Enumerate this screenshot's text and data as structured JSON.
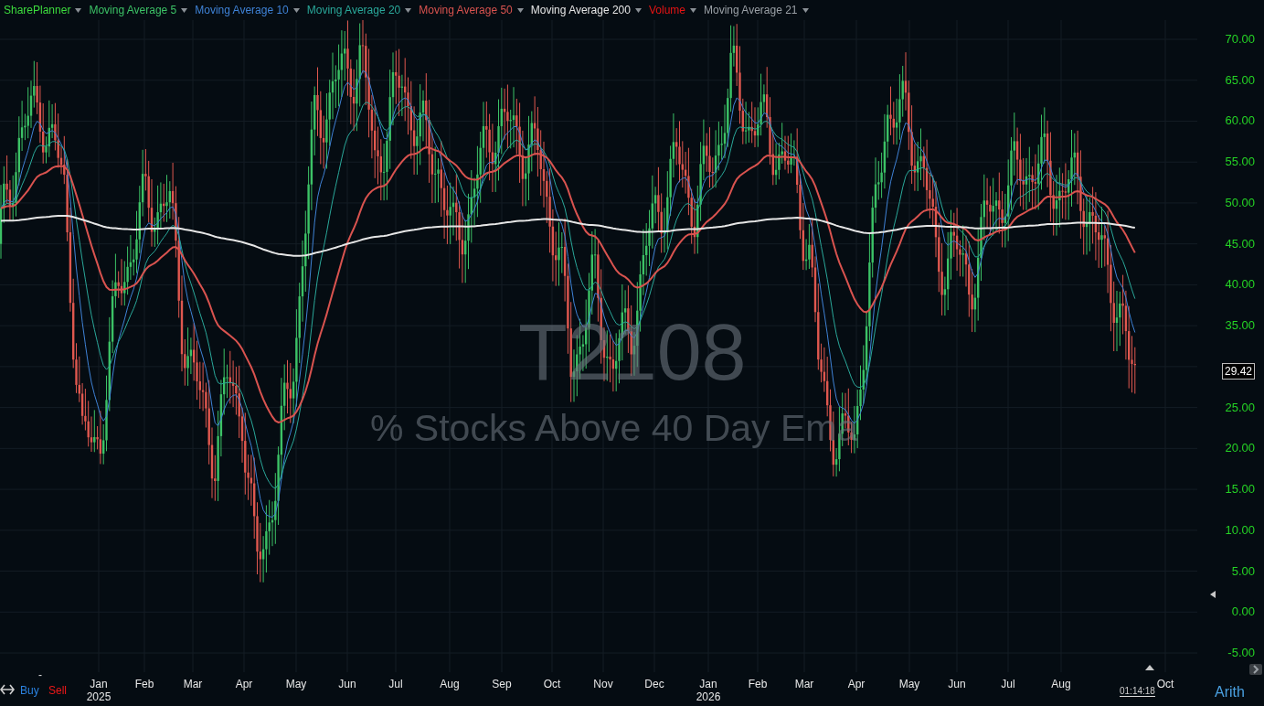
{
  "legend": [
    {
      "label": "SharePlanner",
      "color": "#3ddc3d"
    },
    {
      "label": "Moving Average 5",
      "color": "#3cc266"
    },
    {
      "label": "Moving Average 10",
      "color": "#3f82d6"
    },
    {
      "label": "Moving Average 20",
      "color": "#2aa89a"
    },
    {
      "label": "Moving Average 50",
      "color": "#d9534f"
    },
    {
      "label": "Moving Average 200",
      "color": "#e6e6e6"
    },
    {
      "label": "Volume",
      "color": "#e81414"
    },
    {
      "label": "Moving Average 21",
      "color": "#9aa0a6"
    }
  ],
  "watermark": {
    "symbol": "T2108",
    "title": "% Stocks Above 40 Day Ema"
  },
  "y_axis": {
    "ticks": [
      "70.00",
      "65.00",
      "60.00",
      "55.00",
      "50.00",
      "45.00",
      "40.00",
      "35.00",
      "25.00",
      "20.00",
      "15.00",
      "10.00",
      "5.00",
      "0.00",
      "-5.00"
    ],
    "last_price": "29.42",
    "scale": "Arith"
  },
  "x_axis": {
    "months": [
      {
        "label": "Jan",
        "year": "2025"
      },
      {
        "label": "Feb"
      },
      {
        "label": "Mar"
      },
      {
        "label": "Apr"
      },
      {
        "label": "May"
      },
      {
        "label": "Jun"
      },
      {
        "label": "Jul"
      },
      {
        "label": "Aug"
      },
      {
        "label": "Sep"
      },
      {
        "label": "Oct"
      },
      {
        "label": "Nov"
      },
      {
        "label": "Dec"
      },
      {
        "label": "Jan",
        "year": "2026"
      },
      {
        "label": "Feb"
      },
      {
        "label": "Mar"
      },
      {
        "label": "Apr"
      },
      {
        "label": "May"
      },
      {
        "label": "Jun"
      },
      {
        "label": "Jul"
      },
      {
        "label": "Aug"
      },
      {
        "label": "Oct"
      }
    ],
    "countdown": "01:14:18"
  },
  "trade": {
    "buy": "Buy",
    "sell": "Sell",
    "dash": "-"
  }
}
